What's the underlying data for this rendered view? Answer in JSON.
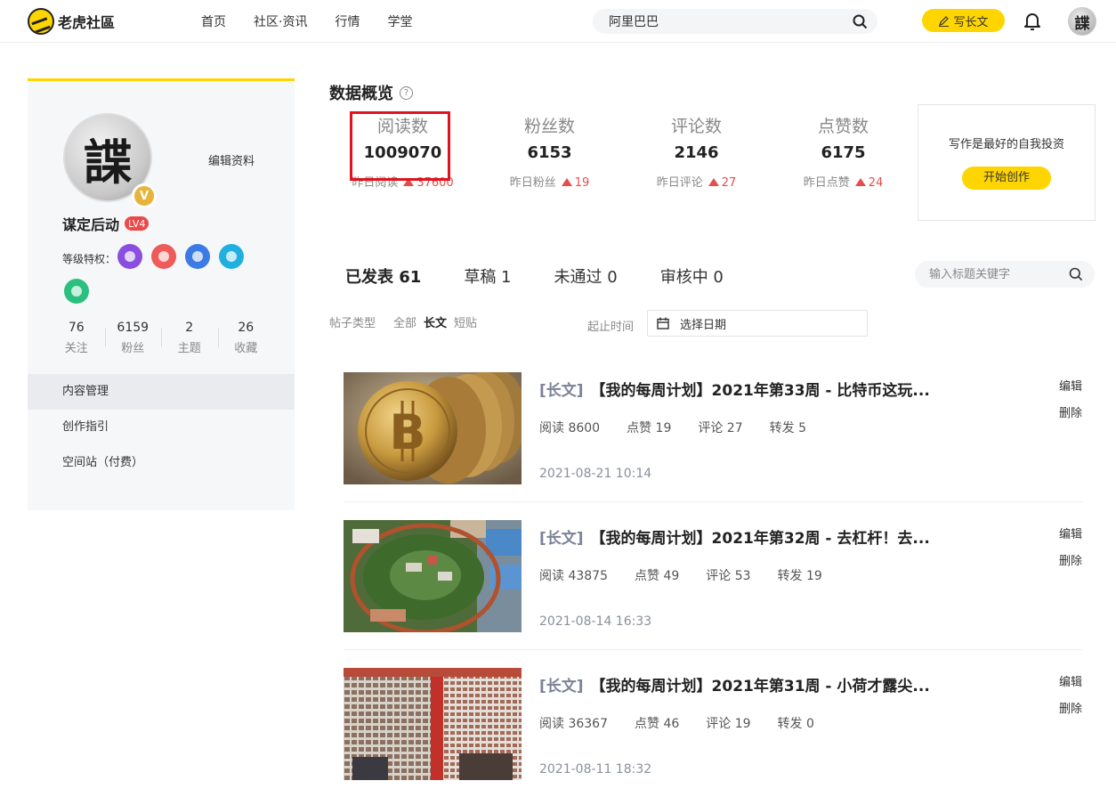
{
  "header": {
    "logo_text": "老虎社區",
    "nav": [
      "首页",
      "社区·资讯",
      "行情",
      "学堂"
    ],
    "search_value": "阿里巴巴",
    "write_label": "写长文",
    "avatar_char": "諜"
  },
  "sidebar": {
    "avatar_char": "諜",
    "verified_badge": "V",
    "edit_profile": "编辑资料",
    "username": "谋定后动",
    "level": "LV4",
    "privileges_label": "等级特权：",
    "privilege_colors": [
      "#8a4fe0",
      "#ef5a5a",
      "#3c7be6",
      "#1fb0e0",
      "#2bc07f"
    ],
    "stats": [
      {
        "num": "76",
        "label": "关注"
      },
      {
        "num": "6159",
        "label": "粉丝"
      },
      {
        "num": "2",
        "label": "主题"
      },
      {
        "num": "26",
        "label": "收藏"
      }
    ],
    "menu": [
      "内容管理",
      "创作指引",
      "空间站（付费）"
    ]
  },
  "overview": {
    "title": "数据概览",
    "help": "?",
    "metrics": [
      {
        "label": "阅读数",
        "value": "1009070",
        "sub": "昨日阅读",
        "delta": "37600"
      },
      {
        "label": "粉丝数",
        "value": "6153",
        "sub": "昨日粉丝",
        "delta": "19"
      },
      {
        "label": "评论数",
        "value": "2146",
        "sub": "昨日评论",
        "delta": "27"
      },
      {
        "label": "点赞数",
        "value": "6175",
        "sub": "昨日点赞",
        "delta": "24"
      }
    ],
    "promo_text": "写作是最好的自我投资",
    "promo_button": "开始创作"
  },
  "content": {
    "tabs": [
      "已发表 61",
      "草稿 1",
      "未通过 0",
      "审核中 0"
    ],
    "keyword_placeholder": "输入标题关键字",
    "filter_label": "帖子类型",
    "filter_options": [
      "全部",
      "长文",
      "短贴"
    ],
    "date_label": "起止时间",
    "date_placeholder": "选择日期"
  },
  "posts": [
    {
      "tag": "[长文]",
      "title": "【我的每周计划】2021年第33周 - 比特币这玩...",
      "read": "阅读 8600",
      "like": "点赞 19",
      "comment": "评论 27",
      "share": "转发 5",
      "date": "2021-08-21 10:14",
      "edit": "编辑",
      "delete": "删除",
      "image": "bitcoin-coin"
    },
    {
      "tag": "[长文]",
      "title": "【我的每周计划】2021年第32周 - 去杠杆！去...",
      "read": "阅读 43875",
      "like": "点赞 49",
      "comment": "评论 53",
      "share": "转发 19",
      "date": "2021-08-14 16:33",
      "edit": "编辑",
      "delete": "删除",
      "image": "aerial-park"
    },
    {
      "tag": "[长文]",
      "title": "【我的每周计划】2021年第31周 - 小荷才露尖...",
      "read": "阅读 36367",
      "like": "点赞 46",
      "comment": "评论 19",
      "share": "转发 0",
      "date": "2021-08-11 18:32",
      "edit": "编辑",
      "delete": "删除",
      "image": "building-facade"
    }
  ],
  "colors": {
    "brand": "#ffd500",
    "up": "#e84b4b",
    "highlight": "#e0141e"
  }
}
